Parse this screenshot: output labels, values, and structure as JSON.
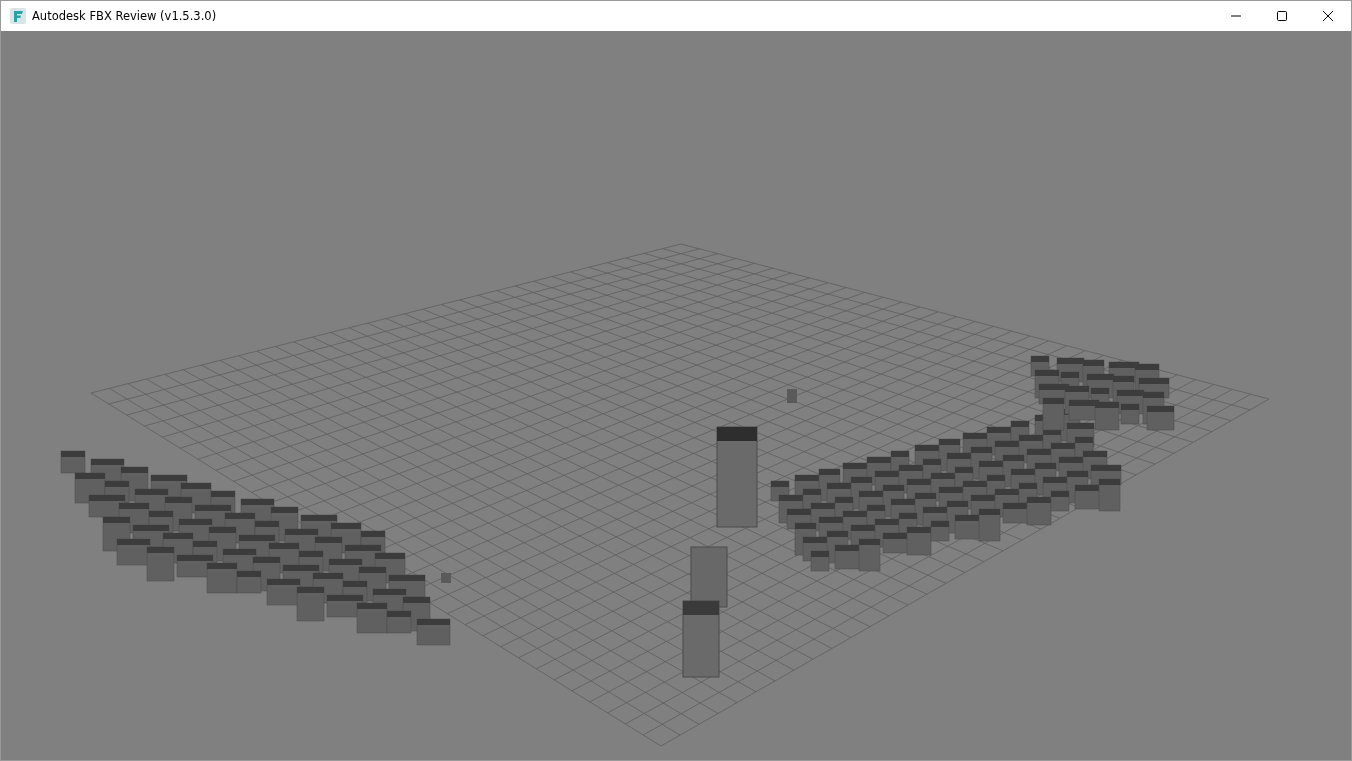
{
  "window": {
    "title": "Autodesk FBX Review (v1.5.3.0)"
  }
}
